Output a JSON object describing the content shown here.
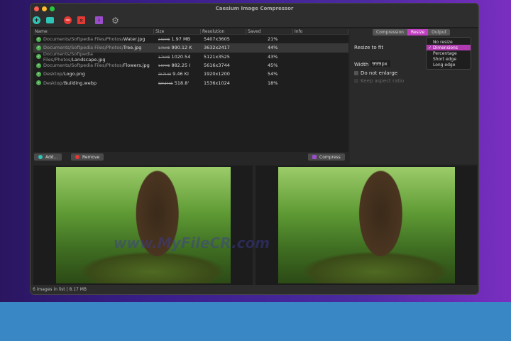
{
  "window": {
    "title": "Caesium Image Compressor"
  },
  "toolbar": {
    "icons": [
      "add-icon",
      "open-folder-icon",
      "remove-icon",
      "clear-list-icon",
      "compress-archive-icon",
      "settings-gear-icon"
    ]
  },
  "table": {
    "headers": [
      "Name",
      "Size",
      "Resolution",
      "Saved",
      "Info"
    ],
    "rows": [
      {
        "dir": "Documents/Softpedia Files/Photos/",
        "file": "Water.jpg",
        "old": "2.50 MB",
        "new": "1.97 MB",
        "res": "5407x3605",
        "saved": "21%"
      },
      {
        "dir": "Documents/Softpedia Files/Photos/",
        "file": "Tree.jpg",
        "old": "1.74 MB",
        "new": "990.12 K",
        "res": "3632x2417",
        "saved": "44%"
      },
      {
        "dir": "Documents/Softpedia Files/Photos/",
        "file": "Landscape.jpg",
        "old": "1.74 MB",
        "new": "1020.54",
        "res": "5121x3525",
        "saved": "43%"
      },
      {
        "dir": "Documents/Softpedia Files/Photos/",
        "file": "Flowers.jpg",
        "old": "1.57 MB",
        "new": "882.25 I",
        "res": "5616x3744",
        "saved": "45%"
      },
      {
        "dir": "Desktop/",
        "file": "Logo.png",
        "old": "20.75 KB",
        "new": "9.46 KI",
        "res": "1920x1200",
        "saved": "54%"
      },
      {
        "dir": "Desktop/",
        "file": "Building.webp",
        "old": "629.87 KB",
        "new": "518.8'",
        "res": "1536x1024",
        "saved": "18%"
      }
    ]
  },
  "buttons": {
    "add": "Add...",
    "remove": "Remove",
    "compress": "Compress"
  },
  "tabs": [
    "Compression",
    "Resize",
    "Output"
  ],
  "resize": {
    "label": "Resize to fit",
    "width_label": "Width",
    "width_value": "999px",
    "do_not_enlarge": "Do not enlarge",
    "keep_aspect": "Keep aspect ratio",
    "options": [
      "No resize",
      "Dimensions",
      "Percentage",
      "Short edge",
      "Long edge"
    ],
    "selected": "Dimensions"
  },
  "watermark": "www.MyFileCR.com",
  "status": "6 images in list | 8.17 MB",
  "colors": {
    "accent": "#c040c0",
    "band": "#3a87c6"
  }
}
